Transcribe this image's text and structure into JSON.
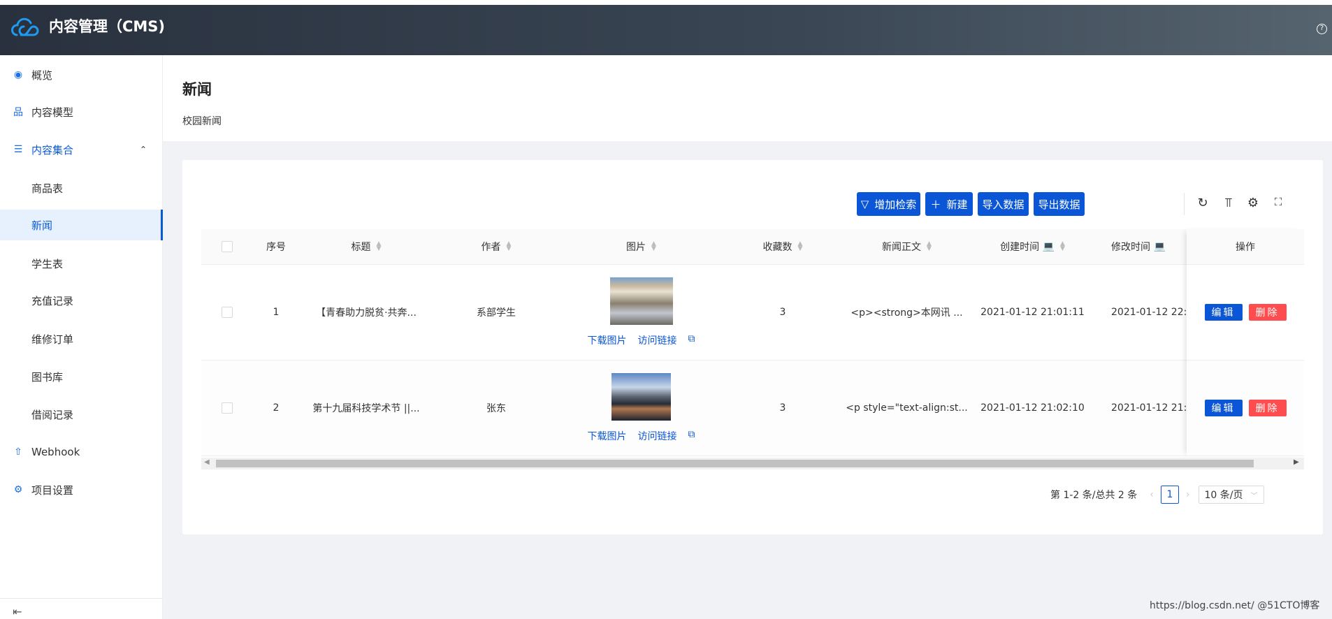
{
  "app": {
    "title": "内容管理（CMS)",
    "help_icon": "question-circle-icon"
  },
  "sidebar": {
    "items": [
      {
        "label": "概览",
        "icon": "eye-icon"
      },
      {
        "label": "内容模型",
        "icon": "cluster-icon"
      },
      {
        "label": "内容集合",
        "icon": "database-icon",
        "expanded": true
      },
      {
        "label": "商品表"
      },
      {
        "label": "新闻",
        "active": true
      },
      {
        "label": "学生表"
      },
      {
        "label": "充值记录"
      },
      {
        "label": "维修订单"
      },
      {
        "label": "图书库"
      },
      {
        "label": "借阅记录"
      },
      {
        "label": "Webhook",
        "icon": "rocket-icon"
      },
      {
        "label": "项目设置",
        "icon": "setting-icon"
      }
    ]
  },
  "page": {
    "title": "新闻",
    "subtitle": "校园新闻"
  },
  "toolbar": {
    "add_filter": "增加检索",
    "create": "新建",
    "import": "导入数据",
    "export": "导出数据"
  },
  "table": {
    "headers": [
      "序号",
      "标题",
      "作者",
      "图片",
      "收藏数",
      "新闻正文",
      "创建时间",
      "修改时间",
      "操作"
    ],
    "rows": [
      {
        "index": "1",
        "title": "【青春助力脱贫·共奔...",
        "author": "系部学生",
        "favorites": "3",
        "content": "<p><strong>本网讯 ...",
        "created": "2021-01-12 21:01:11",
        "modified": "2021-01-12 22:0"
      },
      {
        "index": "2",
        "title": "第十九届科技学术节 ||...",
        "author": "张东",
        "favorites": "3",
        "content": "<p style=\"text-align:st...",
        "created": "2021-01-12 21:02:10",
        "modified": "2021-01-12 21:"
      }
    ],
    "download_label": "下载图片",
    "link_label": "访问链接",
    "edit_label": "编辑",
    "delete_label": "删除"
  },
  "pagination": {
    "summary": "第 1-2 条/总共 2 条",
    "current": "1",
    "page_size": "10 条/页"
  },
  "watermark": "https://blog.csdn.net/ @51CTO博客",
  "colors": {
    "primary": "#0a56d6",
    "danger": "#ff4d4f",
    "header_bg": "#29313e"
  }
}
